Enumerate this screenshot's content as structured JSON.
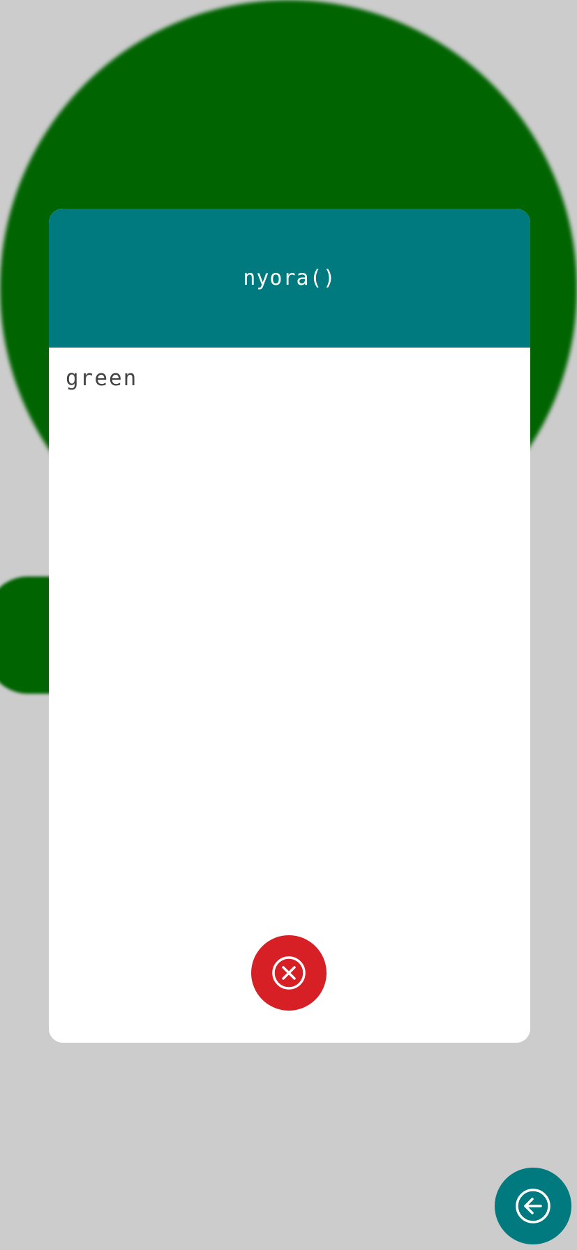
{
  "dialog": {
    "title": "nyora()",
    "body_text": "green"
  },
  "buttons": {
    "close_icon": "close-circle-icon",
    "back_icon": "arrow-left-circle-icon"
  },
  "colors": {
    "background": "#cccccc",
    "green_shape": "#006400",
    "header": "#007a7e",
    "close_button": "#d71f26",
    "back_button": "#007a7e"
  }
}
